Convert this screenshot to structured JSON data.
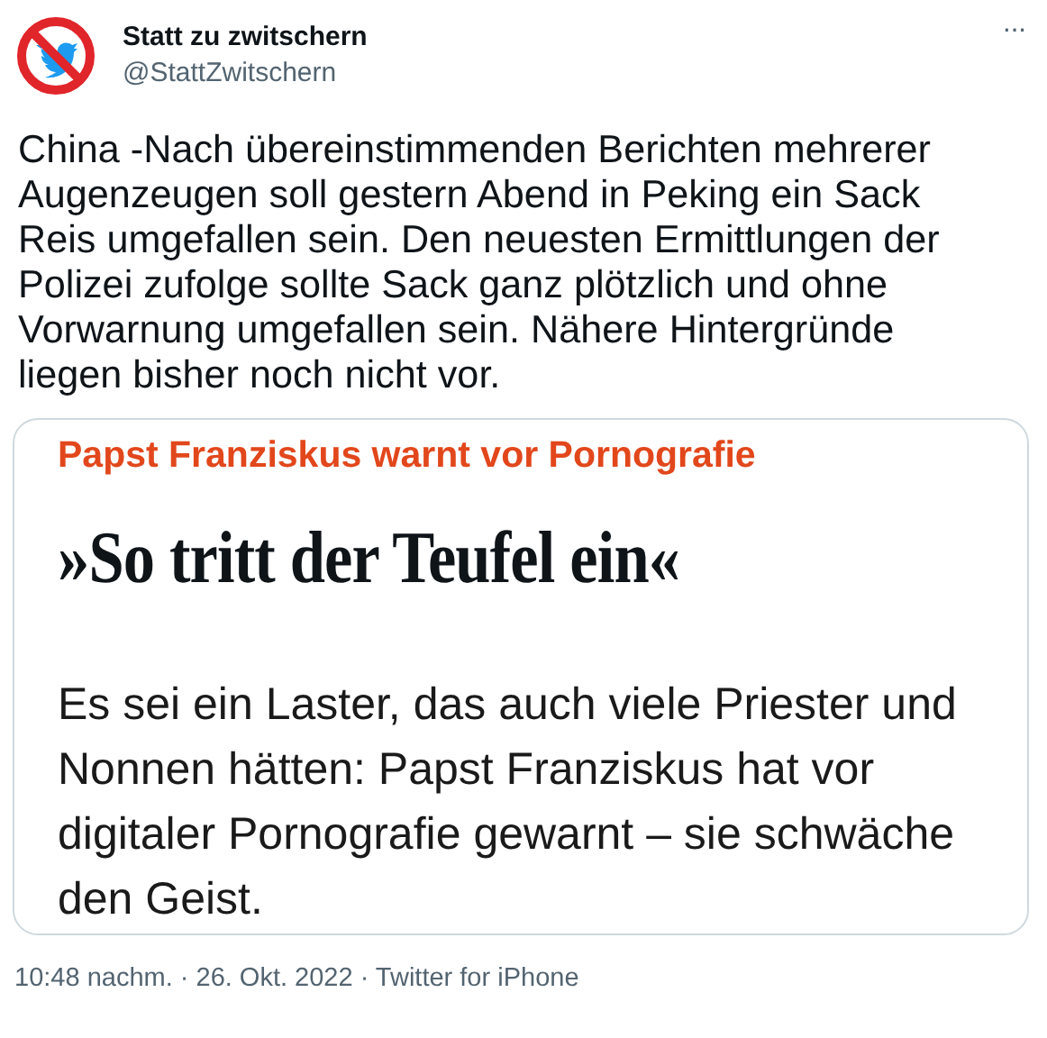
{
  "author": {
    "name": "Statt zu zwitschern",
    "handle": "@StattZwitschern"
  },
  "menu": "···",
  "text": "China -Nach übereinstimmenden Berichten mehrerer Augenzeugen soll gestern Abend in Peking ein Sack Reis umgefallen sein. Den neuesten Ermittlungen der Polizei zufolge sollte Sack ganz plötzlich und ohne Vorwarnung umgefallen sein. Nähere Hintergründe liegen bisher noch nicht vor.",
  "attachment": {
    "kicker": "Papst Franziskus warnt vor Pornografie",
    "headline": "»So tritt der Teufel ein«",
    "teaser": "Es sei ein Laster, das auch viele Priester und Nonnen hätten: Papst Franziskus hat vor digitaler Pornografie gewarnt – sie schwäche den Geist."
  },
  "meta": "10:48 nachm. · 26. Okt. 2022 · Twitter for iPhone"
}
